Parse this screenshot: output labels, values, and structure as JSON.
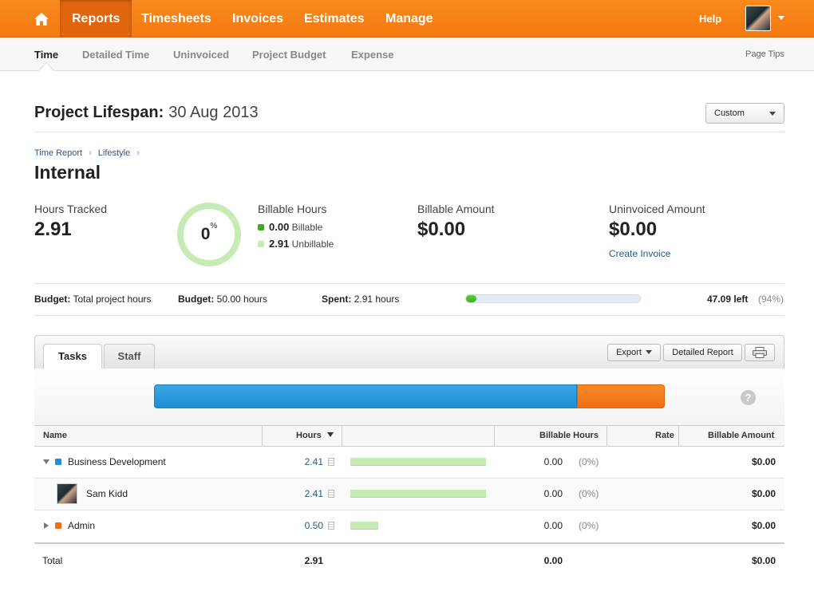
{
  "topnav": {
    "items": [
      "Reports",
      "Timesheets",
      "Invoices",
      "Estimates",
      "Manage"
    ],
    "active": "Reports",
    "help": "Help"
  },
  "subnav": {
    "items": [
      "Time",
      "Detailed Time",
      "Uninvoiced",
      "Project Budget",
      "Expense"
    ],
    "active": "Time",
    "page_tips": "Page Tips"
  },
  "header": {
    "title": "Project Lifespan:",
    "date": "30 Aug 2013",
    "range_select": "Custom"
  },
  "breadcrumb": [
    "Time Report",
    "Lifestyle"
  ],
  "section_title": "Internal",
  "stats": {
    "hours_tracked_label": "Hours Tracked",
    "hours_tracked": "2.91",
    "donut_value": "0",
    "donut_unit": "%",
    "billable_hours_label": "Billable Hours",
    "billable_value": "0.00",
    "billable_label": "Billable",
    "unbillable_value": "2.91",
    "unbillable_label": "Unbillable",
    "billable_amount_label": "Billable Amount",
    "billable_amount": "$0.00",
    "uninvoiced_amount_label": "Uninvoiced Amount",
    "uninvoiced_amount": "$0.00",
    "create_invoice": "Create Invoice"
  },
  "budget": {
    "type_label": "Budget:",
    "type_value": "Total project hours",
    "amount_label": "Budget:",
    "amount_value": "50.00 hours",
    "spent_label": "Spent:",
    "spent_value": "2.91 hours",
    "progress_fraction": 0.06,
    "left": "47.09 left",
    "left_pct": "(94%)"
  },
  "tabs": [
    "Tasks",
    "Staff"
  ],
  "toolbar": {
    "export": "Export",
    "detailed_report": "Detailed Report"
  },
  "colors": {
    "brand_orange": "#f47a0f",
    "task_blue": "#1f8fd2",
    "task_orange": "#f06f12",
    "unbillable_green": "#c6ecb5",
    "billable_green": "#3aab24"
  },
  "distribution": [
    {
      "task": "Business Development",
      "hours": 2.41
    },
    {
      "task": "Admin",
      "hours": 0.5
    }
  ],
  "table": {
    "headers": [
      "Name",
      "Hours",
      "Billable Hours",
      "Rate",
      "Billable Amount"
    ],
    "rows": [
      {
        "name": "Business Development",
        "hours": "2.41",
        "hours_value": 2.41,
        "billable": "0.00",
        "pct": "(0%)",
        "rate": "",
        "amount": "$0.00"
      },
      {
        "name": "Sam Kidd",
        "hours": "2.41",
        "hours_value": 2.41,
        "billable": "0.00",
        "pct": "(0%)",
        "rate": "",
        "amount": "$0.00"
      },
      {
        "name": "Admin",
        "hours": "0.50",
        "hours_value": 0.5,
        "billable": "0.00",
        "pct": "(0%)",
        "rate": "",
        "amount": "$0.00"
      }
    ],
    "total": {
      "label": "Total",
      "hours": "2.91",
      "billable": "0.00",
      "amount": "$0.00"
    }
  }
}
